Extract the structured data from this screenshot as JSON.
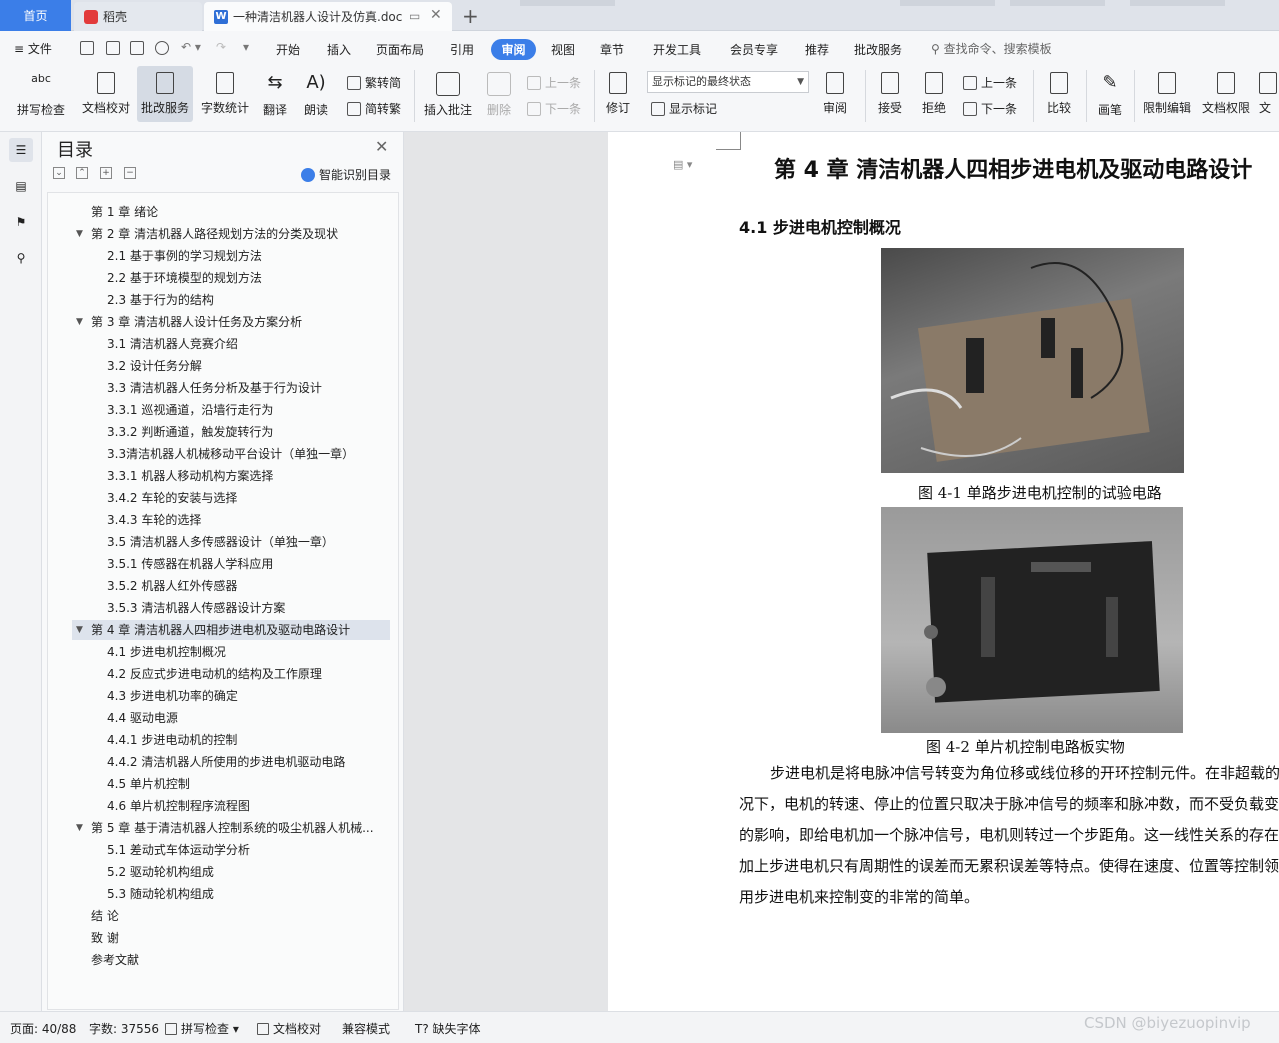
{
  "tabs": {
    "home": "首页",
    "t1": "稻壳",
    "t2": "一种清洁机器人设计及仿真.doc"
  },
  "menu": {
    "file": "文件",
    "items": [
      "开始",
      "插入",
      "页面布局",
      "引用",
      "审阅",
      "视图",
      "章节",
      "开发工具",
      "会员专享",
      "推荐",
      "批改服务"
    ],
    "active": "审阅",
    "search": "查找命令、搜索模板"
  },
  "ribbon": {
    "spell": "拼写检查",
    "proof": "文档校对",
    "grading": "批改服务",
    "wordcount": "字数统计",
    "translate": "翻译",
    "read": "朗读",
    "trad": "繁转简",
    "simp": "简转繁",
    "insert_comment": "插入批注",
    "delete": "删除",
    "prev": "上一条",
    "next": "下一条",
    "revise": "修订",
    "markup_state": "显示标记的最终状态",
    "show_markup": "显示标记",
    "review": "审阅",
    "accept": "接受",
    "reject": "拒绝",
    "prev2": "上一条",
    "next2": "下一条",
    "compare": "比较",
    "pen": "画笔",
    "restrict": "限制编辑",
    "doc_perm": "文档权限",
    "doc_more": "文"
  },
  "toc": {
    "title": "目录",
    "smart": "智能识别目录",
    "items": [
      "第 1 章   绪论",
      "第 2 章   清洁机器人路径规划方法的分类及现状",
      "2.1  基于事例的学习规划方法",
      "2.2  基于环境模型的规划方法",
      "2.3  基于行为的结构",
      "第 3 章  清洁机器人设计任务及方案分析",
      "3.1  清洁机器人竞赛介绍",
      "3.2  设计任务分解",
      "3.3  清洁机器人任务分析及基于行为设计",
      "3.3.1  巡视通道，沿墙行走行为",
      "3.3.2  判断通道，触发旋转行为",
      "3.3清洁机器人机械移动平台设计（单独一章）",
      "3.3.1  机器人移动机构方案选择",
      "3.4.2  车轮的安装与选择",
      "3.4.3  车轮的选择",
      "3.5  清洁机器人多传感器设计（单独一章）",
      "3.5.1  传感器在机器人学科应用",
      "3.5.2  机器人红外传感器",
      "3.5.3 清洁机器人传感器设计方案",
      "第 4 章  清洁机器人四相步进电机及驱动电路设计",
      "4.1  步进电机控制概况",
      "4.2  反应式步进电动机的结构及工作原理",
      "4.3  步进电机功率的确定",
      "4.4  驱动电源",
      "4.4.1  步进电动机的控制",
      "4.4.2  清洁机器人所使用的步进电机驱动电路",
      "4.5  单片机控制",
      "4.6  单片机控制程序流程图",
      "第 5 章  基于清洁机器人控制系统的吸尘机器人机械...",
      "5.1 差动式车体运动学分析",
      "5.2  驱动轮机构组成",
      "5.3  随动轮机构组成",
      "结  论",
      "致  谢",
      "参考文献"
    ]
  },
  "doc": {
    "h1": "第 4 章  清洁机器人四相步进电机及驱动电路设计",
    "h2": "4.1  步进电机控制概况",
    "cap1": "图 4-1  单路步进电机控制的试验电路",
    "cap2": "图 4-2  单片机控制电路板实物",
    "para": [
      "步进电机是将电脉冲信号转变为角位移或线位移的开环控制元件。在非超载的情",
      "况下，电机的转速、停止的位置只取决于脉冲信号的频率和脉冲数，而不受负载变化",
      "的影响，即给电机加一个脉冲信号，电机则转过一个步距角。这一线性关系的存在，",
      "加上步进电机只有周期性的误差而无累积误差等特点。使得在速度、位置等控制领域",
      "用步进电机来控制变的非常的简单。"
    ]
  },
  "status": {
    "page": "页面: 40/88",
    "words": "字数: 37556",
    "spell": "拼写检查",
    "proof": "文档校对",
    "compat": "兼容模式",
    "missing_font": "缺失字体"
  },
  "watermark": "CSDN @biyezuopinvip"
}
